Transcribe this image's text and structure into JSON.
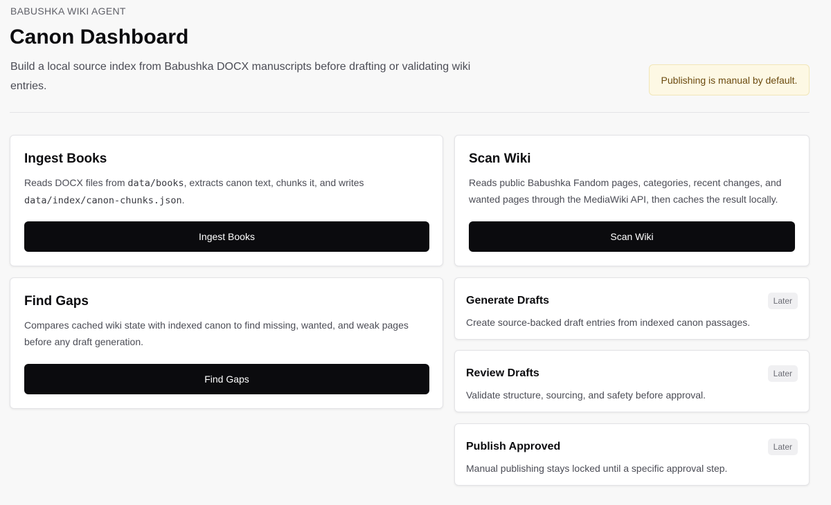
{
  "header": {
    "eyebrow": "BABUSHKA WIKI AGENT",
    "title": "Canon Dashboard",
    "subtitle": "Build a local source index from Babushka DOCX manuscripts before drafting or validating wiki entries.",
    "notice": "Publishing is manual by default."
  },
  "cards": {
    "ingest": {
      "title": "Ingest Books",
      "desc_before": "Reads DOCX files from ",
      "desc_code1": "data/books",
      "desc_middle": ", extracts canon text, chunks it, and writes ",
      "desc_code2": "data/index/canon-chunks.json",
      "desc_after": ".",
      "button": "Ingest Books"
    },
    "scan": {
      "title": "Scan Wiki",
      "desc": "Reads public Babushka Fandom pages, categories, recent changes, and wanted pages through the MediaWiki API, then caches the result locally.",
      "button": "Scan Wiki"
    },
    "gaps": {
      "title": "Find Gaps",
      "desc": "Compares cached wiki state with indexed canon to find missing, wanted, and weak pages before any draft generation.",
      "button": "Find Gaps"
    },
    "generate": {
      "title": "Generate Drafts",
      "badge": "Later",
      "desc": "Create source-backed draft entries from indexed canon passages."
    },
    "review": {
      "title": "Review Drafts",
      "badge": "Later",
      "desc": "Validate structure, sourcing, and safety before approval."
    },
    "publish": {
      "title": "Publish Approved",
      "badge": "Later",
      "desc": "Manual publishing stays locked until a specific approval step."
    }
  }
}
